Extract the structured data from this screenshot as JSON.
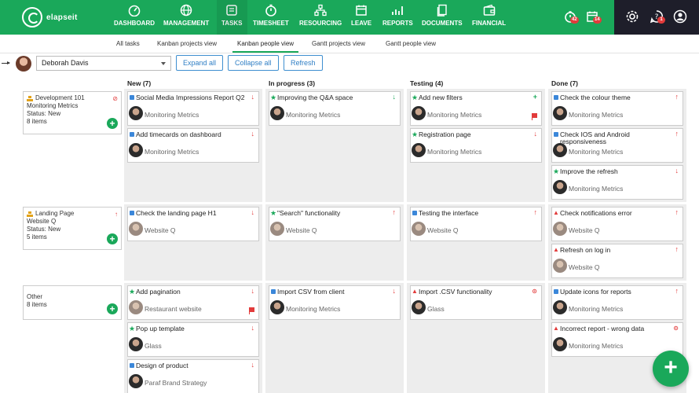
{
  "app": {
    "logo_text": "elapseit"
  },
  "nav": [
    {
      "label": "DASHBOARD",
      "icon": "dashboard-icon"
    },
    {
      "label": "MANAGEMENT",
      "icon": "globe-icon"
    },
    {
      "label": "TASKS",
      "icon": "tasks-icon"
    },
    {
      "label": "TIMESHEET",
      "icon": "stopwatch-icon"
    },
    {
      "label": "RESOURCING",
      "icon": "resourcing-icon"
    },
    {
      "label": "LEAVE",
      "icon": "calendar-icon"
    },
    {
      "label": "REPORTS",
      "icon": "reports-icon"
    },
    {
      "label": "DOCUMENTS",
      "icon": "documents-icon"
    },
    {
      "label": "FINANCIAL",
      "icon": "wallet-icon"
    }
  ],
  "badges": {
    "timer": "42",
    "calendar": "14",
    "help": "1"
  },
  "subtabs": [
    "All tasks",
    "Kanban projects view",
    "Kanban people view",
    "Gantt projects view",
    "Gantt people view"
  ],
  "toolbar": {
    "user": "Deborah Davis",
    "expand_all": "Expand all",
    "collapse_all": "Collapse all",
    "refresh": "Refresh"
  },
  "columns": [
    "New (7)",
    "In progress (3)",
    "Testing (4)",
    "Done (7)"
  ],
  "lanes": [
    {
      "title": "Development 101",
      "project": "Monitoring Metrics",
      "status_label": "Status:",
      "status": "New",
      "count": "8 items"
    },
    {
      "title": "Landing Page",
      "project": "Website Q",
      "status_label": "Status:",
      "status": "New",
      "count": "5 items"
    },
    {
      "title": "Other",
      "count": "8 items"
    }
  ],
  "cards": {
    "lane1": {
      "new": [
        {
          "title": "Social Media Impressions Report Q2",
          "project": "Monitoring Metrics"
        },
        {
          "title": "Add timecards on dashboard",
          "project": "Monitoring Metrics"
        }
      ],
      "progress": [
        {
          "title": "Improving the Q&A space",
          "project": "Monitoring Metrics"
        }
      ],
      "testing": [
        {
          "title": "Add new filters",
          "project": "Monitoring Metrics"
        },
        {
          "title": "Registration page",
          "project": "Monitoring Metrics"
        }
      ],
      "done": [
        {
          "title": "Check the colour theme",
          "project": "Monitoring Metrics"
        },
        {
          "title": "Check IOS and Android responsiveness",
          "project": "Monitoring Metrics"
        },
        {
          "title": "Improve the refresh",
          "project": "Monitoring Metrics"
        }
      ]
    },
    "lane2": {
      "new": [
        {
          "title": "Check the landing page H1",
          "project": "Website Q"
        }
      ],
      "progress": [
        {
          "title": "\"Search\" functionality",
          "project": "Website Q"
        }
      ],
      "testing": [
        {
          "title": "Testing the interface",
          "project": "Website Q"
        }
      ],
      "done": [
        {
          "title": "Check notifications error",
          "project": "Website Q"
        },
        {
          "title": "Refresh on log in",
          "project": "Website Q"
        }
      ]
    },
    "lane3": {
      "new": [
        {
          "title": "Add pagination",
          "project": "Restaurant website"
        },
        {
          "title": "Pop up template",
          "project": "Glass"
        },
        {
          "title": "Design of product",
          "project": "Paraf Brand Strategy"
        }
      ],
      "progress": [
        {
          "title": "Import CSV from client",
          "project": "Monitoring Metrics"
        }
      ],
      "testing": [
        {
          "title": "Import .CSV functionality",
          "project": "Glass"
        }
      ],
      "done": [
        {
          "title": "Update icons for reports",
          "project": "Monitoring Metrics"
        },
        {
          "title": "Incorrect report - wrong data",
          "project": "Monitoring Metrics"
        }
      ]
    }
  },
  "colors": {
    "brand": "#1aa85a",
    "accent_blue": "#3f8fd0",
    "priority_high": "#e23b3b",
    "dark_panel": "#1e1e2a"
  }
}
